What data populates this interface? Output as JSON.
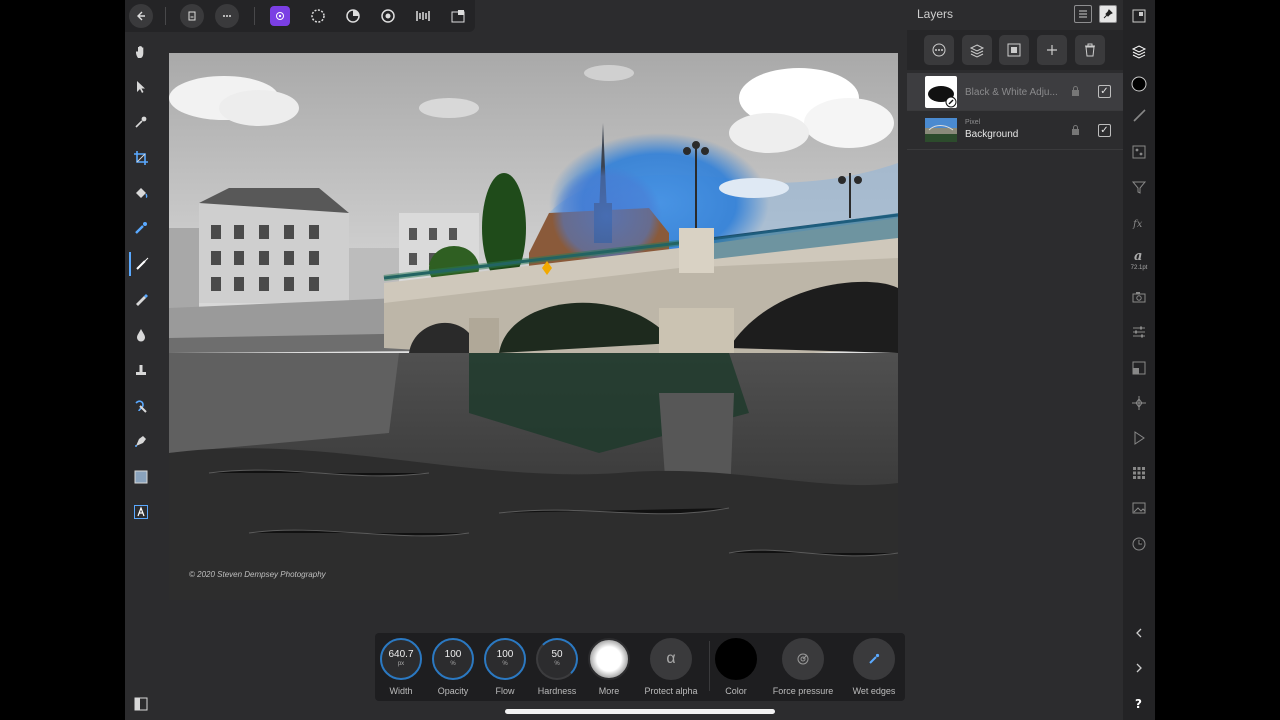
{
  "topbar": {
    "back": "back-arrow-icon",
    "doc": "document-icon",
    "more": "ellipsis-icon",
    "personas": [
      "photo-persona-icon",
      "liquify-persona-icon",
      "develop-persona-icon",
      "tone-mapping-persona-icon",
      "export-persona-icon"
    ],
    "layout": "view-mode-icon"
  },
  "tools": [
    "hand-icon",
    "move-icon",
    "color-picker-icon",
    "crop-icon",
    "flood-fill-icon",
    "selection-brush-icon",
    "paint-brush-icon",
    "erase-brush-icon",
    "burn-brush-icon",
    "clone-brush-icon",
    "smudge-brush-icon",
    "pen-icon",
    "rectangle-icon",
    "artistic-text-icon"
  ],
  "canvas": {
    "copyright": "© 2020 Steven Dempsey Photography",
    "accent": "#1e7fe0"
  },
  "context_toolbar": {
    "controls": [
      {
        "label": "Width",
        "value": "640.7",
        "unit": "px"
      },
      {
        "label": "Opacity",
        "value": "100",
        "unit": "%"
      },
      {
        "label": "Flow",
        "value": "100",
        "unit": "%"
      },
      {
        "label": "Hardness",
        "value": "50",
        "unit": "%"
      }
    ],
    "more_label": "More",
    "protect_alpha_label": "Protect alpha",
    "protect_alpha_glyph": "α",
    "color_label": "Color",
    "color_value": "#000000",
    "force_pressure_label": "Force pressure",
    "wet_edges_label": "Wet edges"
  },
  "layers_panel": {
    "title": "Layers",
    "layers": [
      {
        "name": "Black & White Adju...",
        "kind": "",
        "selected": true,
        "visible": true
      },
      {
        "name": "Background",
        "kind": "Pixel",
        "selected": false,
        "visible": true
      }
    ]
  },
  "studio_strip": {
    "text_size": "72.1pt"
  }
}
